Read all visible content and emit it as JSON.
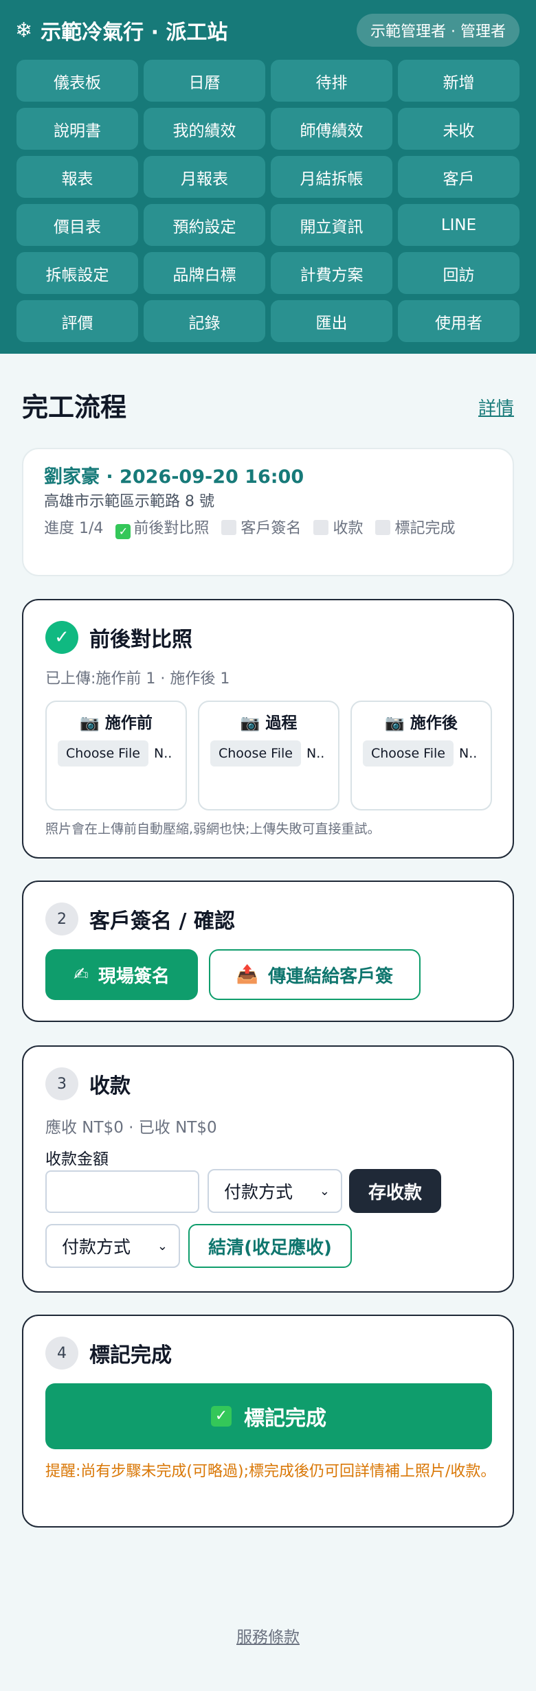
{
  "header": {
    "brand": "示範冷氣行 · 派工站",
    "user": "示範管理者 · 管理者",
    "nav": [
      "儀表板",
      "日曆",
      "待排",
      "新增",
      "說明書",
      "我的績效",
      "師傅績效",
      "未收",
      "報表",
      "月報表",
      "月結拆帳",
      "客戶",
      "價目表",
      "預約設定",
      "開立資訊",
      "LINE",
      "拆帳設定",
      "品牌白標",
      "計費方案",
      "回訪",
      "評價",
      "記錄",
      "匯出",
      "使用者"
    ]
  },
  "page": {
    "title": "完工流程",
    "details_link": "詳情"
  },
  "summary": {
    "title": "劉家豪 · 2026-09-20 16:00",
    "address": "高雄市示範區示範路 8 號",
    "progress_label": "進度 1/4",
    "steps": [
      "前後對比照",
      "客戶簽名",
      "收款",
      "標記完成"
    ]
  },
  "step1": {
    "number": "✓",
    "title": "前後對比照",
    "uploaded": "已上傳:施作前 1 · 施作後 1",
    "slots": [
      {
        "label": "施作前",
        "button": "Choose File",
        "status": "N.."
      },
      {
        "label": "過程",
        "button": "Choose File",
        "status": "N.."
      },
      {
        "label": "施作後",
        "button": "Choose File",
        "status": "N.."
      }
    ],
    "hint": "照片會在上傳前自動壓縮,弱網也快;上傳失敗可直接重試。"
  },
  "step2": {
    "number": "2",
    "title": "客戶簽名 / 確認",
    "sign_button": "現場簽名",
    "send_button": "傳連結給客戶簽"
  },
  "step3": {
    "number": "3",
    "title": "收款",
    "due": "應收 NT$0 · 已收 NT$0",
    "amount_label": "收款金額",
    "amount_value": "",
    "method_select": "付款方式",
    "save_button": "存收款",
    "method_select_2": "付款方式",
    "settle_button": "結清(收足應收)"
  },
  "step4": {
    "number": "4",
    "title": "標記完成",
    "complete_button": "標記完成",
    "warning": "提醒:尚有步驟未完成(可略過);標完成後仍可回詳情補上照片/收款。"
  },
  "footer": {
    "terms": "服務條款"
  },
  "colors": {
    "header": "#177a79",
    "accent_green": "#0f9d6c",
    "warning": "#d97706"
  },
  "icons": {
    "brand": "snowflake-icon",
    "photo": "camera-icon",
    "sign": "writing-hand-icon",
    "send": "outbox-tray-icon",
    "done": "check-mark-icon"
  }
}
